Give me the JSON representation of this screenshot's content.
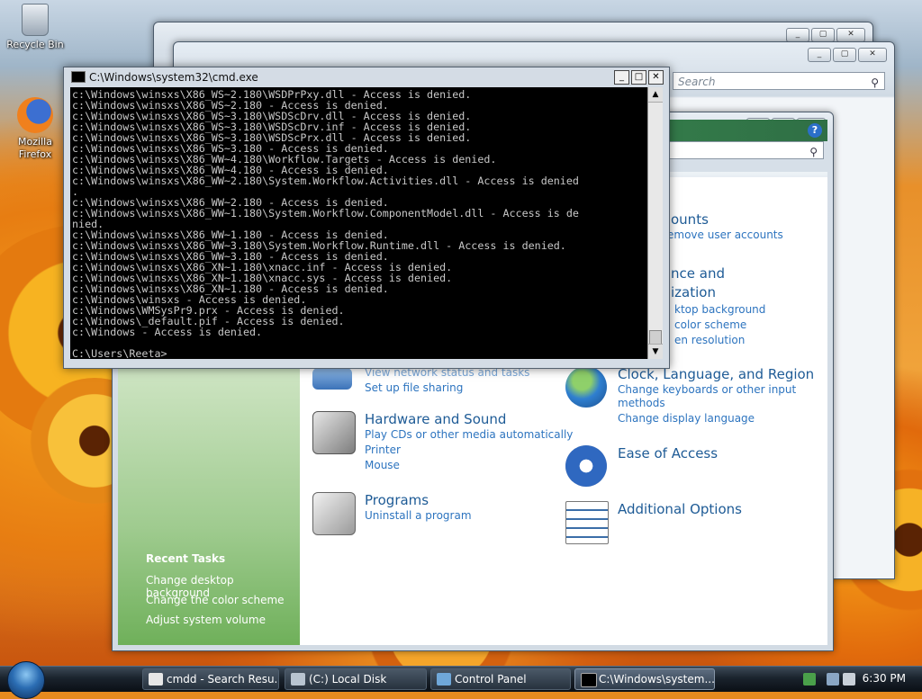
{
  "desktop": {
    "icons": [
      {
        "label": "Recycle Bin"
      },
      {
        "label_line1": "Mozilla",
        "label_line2": "Firefox"
      }
    ]
  },
  "back_windows": {
    "explorer_search_placeholder": "Search"
  },
  "control_panel": {
    "categories": [
      {
        "title_partial": "ounts",
        "links": [
          "emove user accounts"
        ]
      },
      {
        "title_line1": "nce and",
        "title_line2": "ization",
        "links": [
          "ktop background",
          "color scheme",
          "en resolution"
        ]
      },
      {
        "title": "",
        "links": [
          "View network status and tasks",
          "Set up file sharing"
        ]
      },
      {
        "title": "Hardware and Sound",
        "links": [
          "Play CDs or other media automatically",
          "Printer",
          "Mouse"
        ]
      },
      {
        "title": "Programs",
        "links": [
          "Uninstall a program"
        ]
      },
      {
        "title": "Clock, Language, and Region",
        "links": [
          "Change keyboards or other input",
          "methods",
          "Change display language"
        ]
      },
      {
        "title": "Ease of Access",
        "links": []
      },
      {
        "title": "Additional Options",
        "links": []
      }
    ],
    "recent_tasks": {
      "title": "Recent Tasks",
      "items": [
        "Change desktop background",
        "Change the color scheme",
        "Adjust system volume"
      ]
    }
  },
  "cmd": {
    "title": "C:\\Windows\\system32\\cmd.exe",
    "lines": [
      "c:\\Windows\\winsxs\\X86_WS~2.180\\WSDPrPxy.dll - Access is denied.",
      "c:\\Windows\\winsxs\\X86_WS~2.180 - Access is denied.",
      "c:\\Windows\\winsxs\\X86_WS~3.180\\WSDScDrv.dll - Access is denied.",
      "c:\\Windows\\winsxs\\X86_WS~3.180\\WSDScDrv.inf - Access is denied.",
      "c:\\Windows\\winsxs\\X86_WS~3.180\\WSDScPrx.dll - Access is denied.",
      "c:\\Windows\\winsxs\\X86_WS~3.180 - Access is denied.",
      "c:\\Windows\\winsxs\\X86_WW~4.180\\Workflow.Targets - Access is denied.",
      "c:\\Windows\\winsxs\\X86_WW~4.180 - Access is denied.",
      "c:\\Windows\\winsxs\\X86_WW~2.180\\System.Workflow.Activities.dll - Access is denied",
      ".",
      "c:\\Windows\\winsxs\\X86_WW~2.180 - Access is denied.",
      "c:\\Windows\\winsxs\\X86_WW~1.180\\System.Workflow.ComponentModel.dll - Access is de",
      "nied.",
      "c:\\Windows\\winsxs\\X86_WW~1.180 - Access is denied.",
      "c:\\Windows\\winsxs\\X86_WW~3.180\\System.Workflow.Runtime.dll - Access is denied.",
      "c:\\Windows\\winsxs\\X86_WW~3.180 - Access is denied.",
      "c:\\Windows\\winsxs\\X86_XN~1.180\\xnacc.inf - Access is denied.",
      "c:\\Windows\\winsxs\\X86_XN~1.180\\xnacc.sys - Access is denied.",
      "c:\\Windows\\winsxs\\X86_XN~1.180 - Access is denied.",
      "c:\\Windows\\winsxs - Access is denied.",
      "c:\\Windows\\WMSysPr9.prx - Access is denied.",
      "c:\\Windows\\_default.pif - Access is denied.",
      "c:\\Windows - Access is denied.",
      "",
      "C:\\Users\\Reeta>_"
    ]
  },
  "taskbar": {
    "tasks": [
      {
        "label": "cmdd - Search Resu..."
      },
      {
        "label": "(C:) Local Disk"
      },
      {
        "label": "Control Panel"
      },
      {
        "label": "C:\\Windows\\system..."
      }
    ],
    "clock": "6:30 PM"
  }
}
